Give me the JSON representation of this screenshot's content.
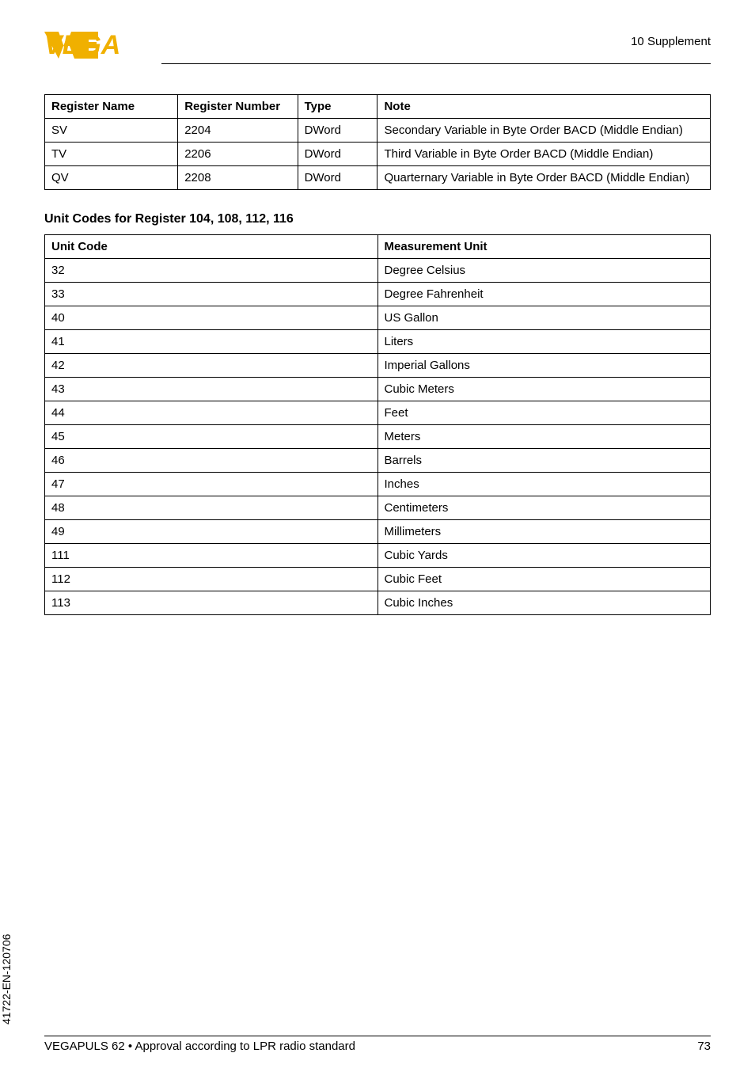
{
  "header": {
    "section_label": "10   Supplement"
  },
  "table_registers": {
    "headers": [
      "Register Name",
      "Register Number",
      "Type",
      "Note"
    ],
    "rows": [
      {
        "name": "SV",
        "number": "2204",
        "type": "DWord",
        "note": "Secondary Variable in Byte Order BACD (Middle Endian)"
      },
      {
        "name": "TV",
        "number": "2206",
        "type": "DWord",
        "note": "Third Variable in Byte Order BACD (Middle Endian)"
      },
      {
        "name": "QV",
        "number": "2208",
        "type": "DWord",
        "note": "Quarternary Variable in Byte Order BACD (Middle Endian)"
      }
    ]
  },
  "subheading": "Unit Codes for Register 104, 108, 112, 116",
  "table_units": {
    "headers": [
      "Unit Code",
      "Measurement Unit"
    ],
    "rows": [
      {
        "code": "32",
        "unit": "Degree Celsius"
      },
      {
        "code": "33",
        "unit": "Degree Fahrenheit"
      },
      {
        "code": "40",
        "unit": "US Gallon"
      },
      {
        "code": "41",
        "unit": "Liters"
      },
      {
        "code": "42",
        "unit": "Imperial Gallons"
      },
      {
        "code": "43",
        "unit": "Cubic Meters"
      },
      {
        "code": "44",
        "unit": "Feet"
      },
      {
        "code": "45",
        "unit": "Meters"
      },
      {
        "code": "46",
        "unit": "Barrels"
      },
      {
        "code": "47",
        "unit": "Inches"
      },
      {
        "code": "48",
        "unit": "Centimeters"
      },
      {
        "code": "49",
        "unit": "Millimeters"
      },
      {
        "code": "111",
        "unit": "Cubic Yards"
      },
      {
        "code": "112",
        "unit": "Cubic Feet"
      },
      {
        "code": "113",
        "unit": "Cubic Inches"
      }
    ]
  },
  "side_text": "41722-EN-120706",
  "footer": {
    "left": "VEGAPULS 62 • Approval according to LPR radio standard",
    "right": "73"
  }
}
